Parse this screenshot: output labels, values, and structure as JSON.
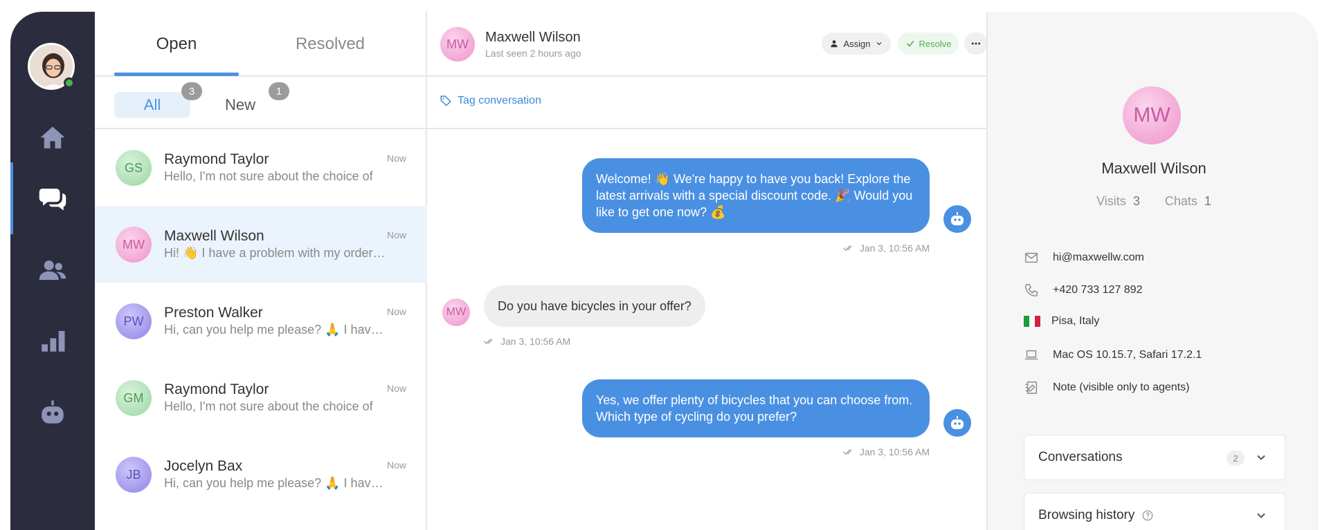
{
  "tabs": {
    "open": "Open",
    "resolved": "Resolved"
  },
  "filters": {
    "all": "All",
    "all_count": "3",
    "new": "New",
    "new_count": "1"
  },
  "conversations": [
    {
      "initials": "GS",
      "name": "Raymond Taylor",
      "preview": "Hello, I'm not sure about the choice of",
      "time": "Now",
      "color": "green"
    },
    {
      "initials": "MW",
      "name": "Maxwell Wilson",
      "preview": "Hi! 👋  I have a problem with my order and",
      "time": "Now",
      "color": "pink"
    },
    {
      "initials": "PW",
      "name": "Preston Walker",
      "preview": "Hi, can you help me please? 🙏 I have a",
      "time": "Now",
      "color": "purple"
    },
    {
      "initials": "GM",
      "name": "Raymond Taylor",
      "preview": "Hello, I'm not sure about the choice of",
      "time": "Now",
      "color": "green"
    },
    {
      "initials": "JB",
      "name": "Jocelyn Bax",
      "preview": "Hi, can you help me please? 🙏 I have a",
      "time": "Now",
      "color": "purple"
    }
  ],
  "chat": {
    "initials": "MW",
    "name": "Maxwell Wilson",
    "last_seen": "Last seen 2 hours ago",
    "assign": "Assign",
    "resolve": "Resolve",
    "tag": "Tag conversation",
    "messages": [
      {
        "text": "Welcome! 👋 We're happy to have you back! Explore the latest arrivals with a special discount code. 🎉 Would you like to get one now? 💰",
        "time": "Jan 3, 10:56 AM"
      },
      {
        "text": "Do you have bicycles in your offer?",
        "time": "Jan 3, 10:56 AM"
      },
      {
        "text": "Yes, we offer plenty of bicycles that you can choose from. Which type of cycling do you prefer?",
        "time": "Jan 3, 10:56 AM"
      }
    ]
  },
  "profile": {
    "initials": "MW",
    "name": "Maxwell Wilson",
    "visits_label": "Visits",
    "visits": "3",
    "chats_label": "Chats",
    "chats": "1",
    "email": "hi@maxwellw.com",
    "phone": "+420 733 127 892",
    "location": "Pisa, Italy",
    "system": "Mac OS 10.15.7, Safari 17.2.1",
    "note": "Note (visible only to agents)",
    "conversations_label": "Conversations",
    "conversations_count": "2",
    "browsing_label": "Browsing history"
  },
  "colors": {
    "accent": "#4a90e2",
    "rail": "#2b2c3d",
    "success": "#4caf50"
  }
}
